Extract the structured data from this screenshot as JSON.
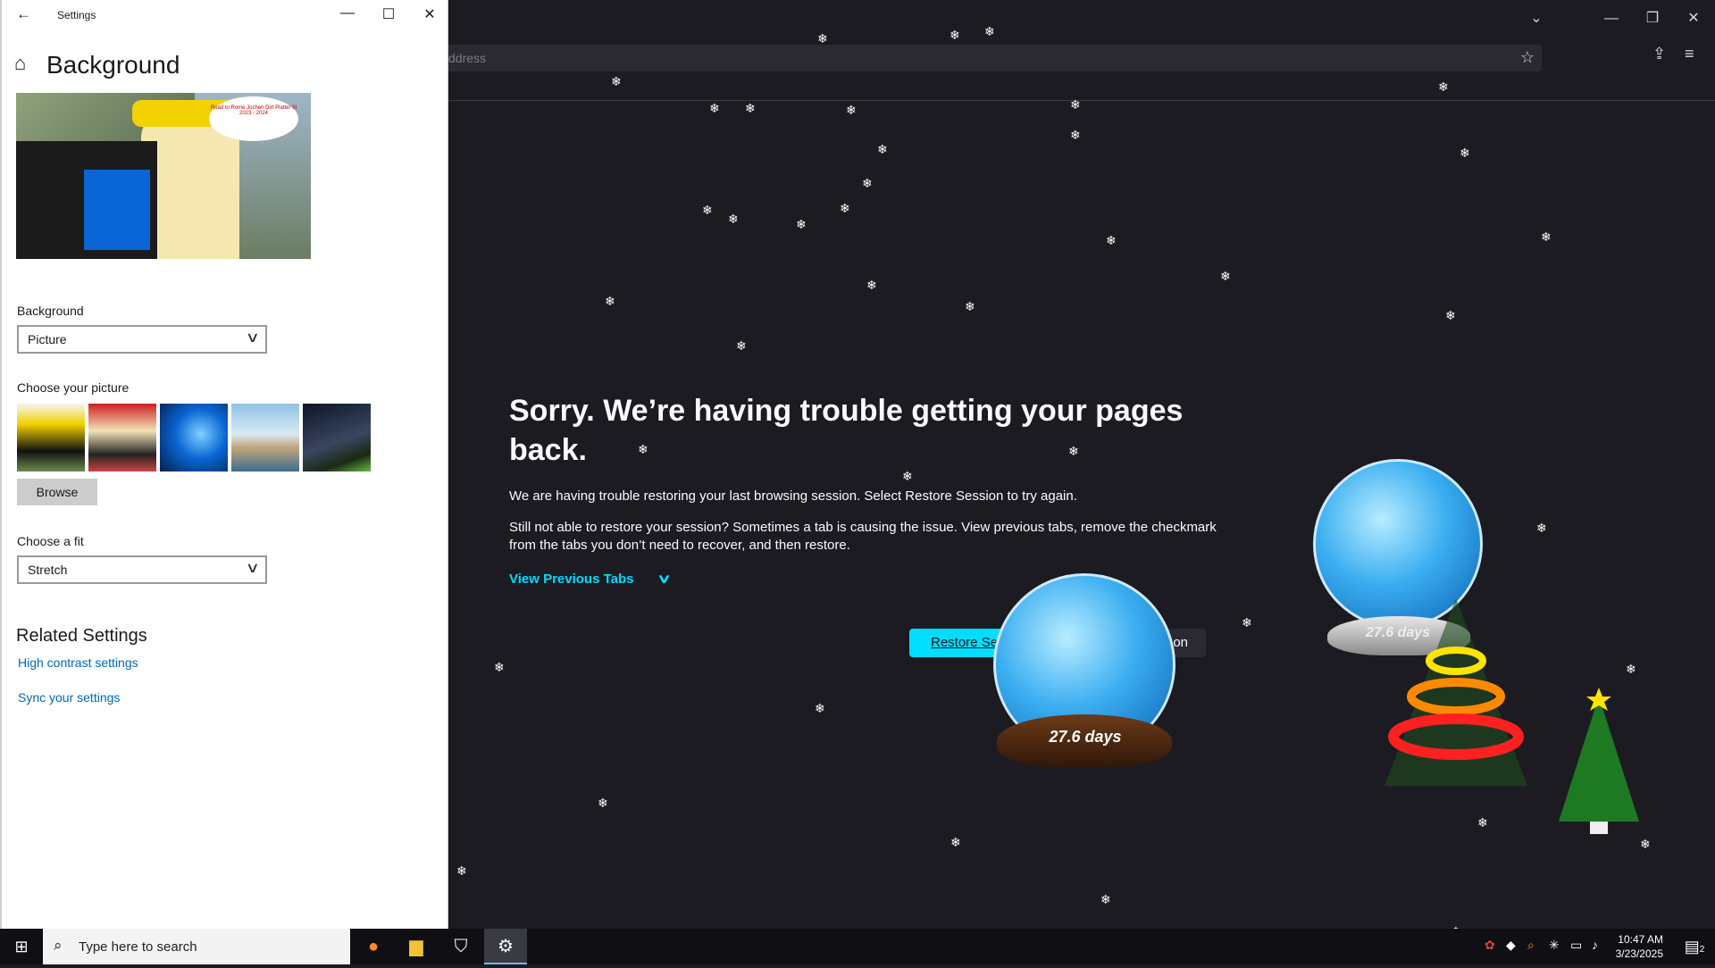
{
  "browser": {
    "url_placeholder": "ddress",
    "restore": {
      "heading": "Sorry. We’re having trouble getting your pages back.",
      "para1": "We are having trouble restoring your last browsing session. Select Restore Session to try again.",
      "para2": "Still not able to restore your session? Sometimes a tab is causing the issue. View previous tabs, remove the checkmark from the tabs you don’t need to recover, and then restore.",
      "view_previous": "View Previous Tabs",
      "restore_button": "Restore Se",
      "close_button_fragment": "on"
    },
    "icons": {
      "star": "bookmark-star-icon",
      "extensions": "extensions-icon",
      "menu": "hamburger-menu-icon"
    }
  },
  "gadgets": {
    "snow_globe_front_label": "27.6 days",
    "snow_globe_back_label": "27.6 days"
  },
  "settings": {
    "window_title": "Settings",
    "page_title": "Background",
    "preview_bubble": "Road to Rome Jochen Dirt Platter III 2023 - 2024",
    "background_label": "Background",
    "background_value": "Picture",
    "choose_picture_label": "Choose your picture",
    "browse_label": "Browse",
    "choose_fit_label": "Choose a fit",
    "fit_value": "Stretch",
    "related_heading": "Related Settings",
    "links": [
      "High contrast settings",
      "Sync your settings"
    ]
  },
  "taskbar": {
    "search_placeholder": "Type here to search",
    "time": "10:47 AM",
    "date": "3/23/2025",
    "notifications_count": "2"
  },
  "colors": {
    "browser_bg": "#1c1b22",
    "accent_cyan": "#00ddff",
    "settings_link": "#0067b8",
    "windows_blue": "#0a66d4"
  }
}
